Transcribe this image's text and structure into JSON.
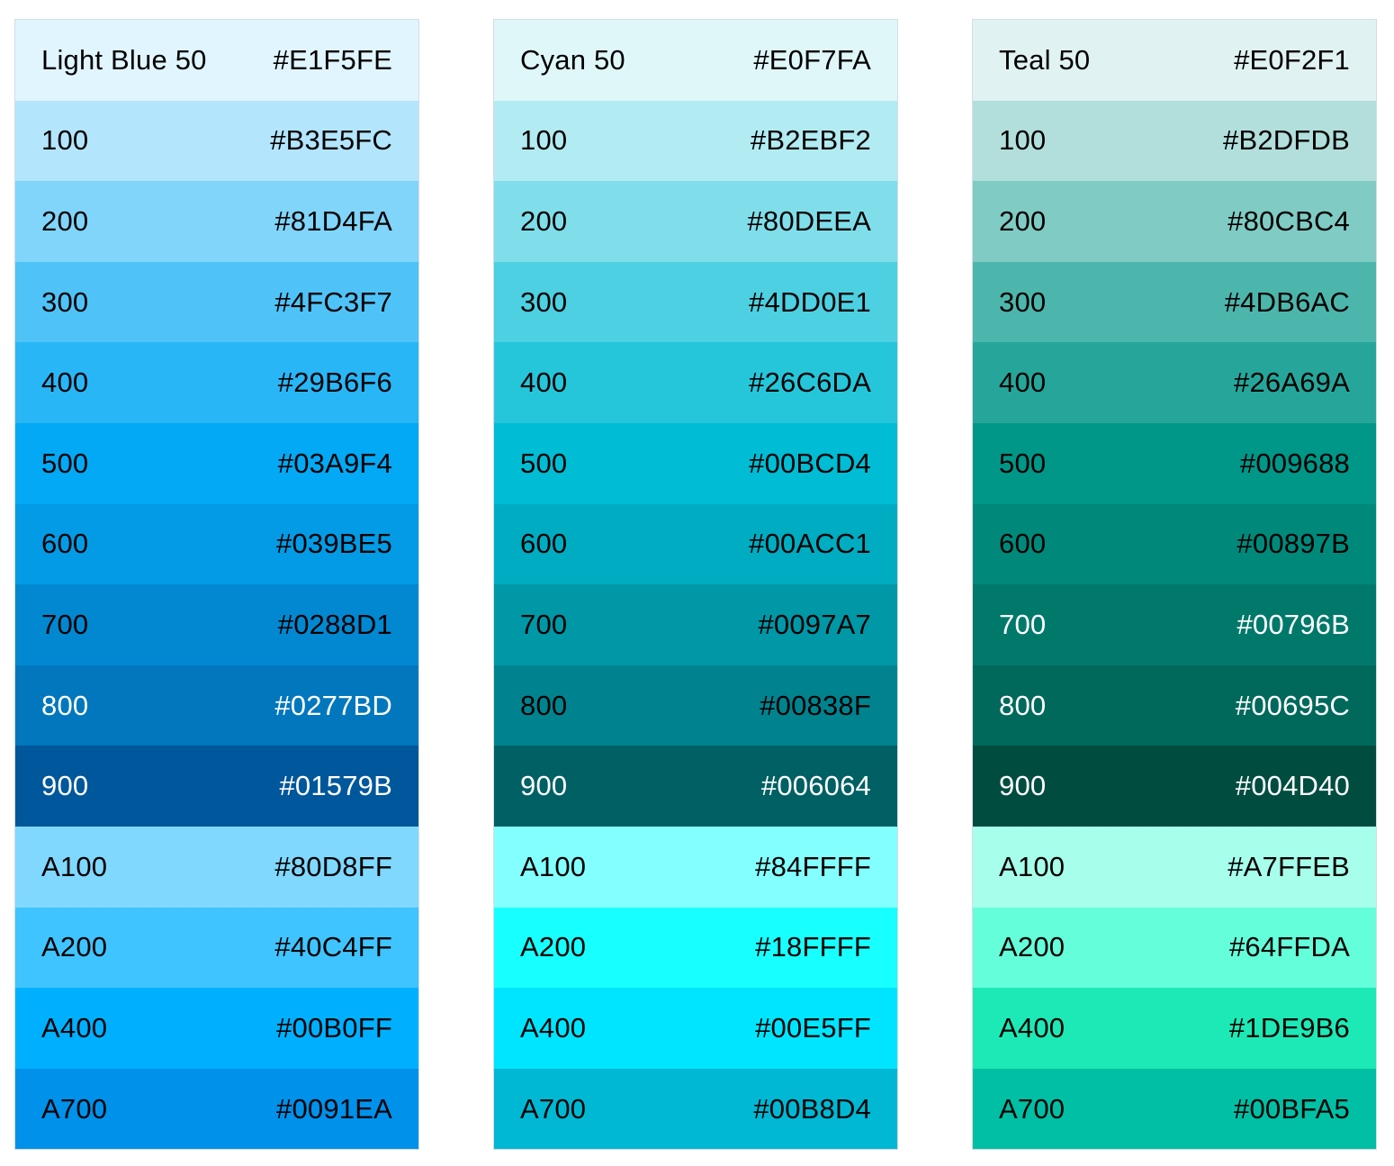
{
  "palettes": [
    {
      "name": "Light Blue",
      "swatches": [
        {
          "label": "Light Blue 50",
          "hex": "#E1F5FE",
          "bg": "#E1F5FE",
          "text": "#000000"
        },
        {
          "label": "100",
          "hex": "#B3E5FC",
          "bg": "#B3E5FC",
          "text": "#000000"
        },
        {
          "label": "200",
          "hex": "#81D4FA",
          "bg": "#81D4FA",
          "text": "#000000"
        },
        {
          "label": "300",
          "hex": "#4FC3F7",
          "bg": "#4FC3F7",
          "text": "#000000"
        },
        {
          "label": "400",
          "hex": "#29B6F6",
          "bg": "#29B6F6",
          "text": "#000000"
        },
        {
          "label": "500",
          "hex": "#03A9F4",
          "bg": "#03A9F4",
          "text": "#000000"
        },
        {
          "label": "600",
          "hex": "#039BE5",
          "bg": "#039BE5",
          "text": "#000000"
        },
        {
          "label": "700",
          "hex": "#0288D1",
          "bg": "#0288D1",
          "text": "#000000"
        },
        {
          "label": "800",
          "hex": "#0277BD",
          "bg": "#0277BD",
          "text": "#FFFFFF"
        },
        {
          "label": "900",
          "hex": "#01579B",
          "bg": "#01579B",
          "text": "#FFFFFF"
        },
        {
          "label": "A100",
          "hex": "#80D8FF",
          "bg": "#80D8FF",
          "text": "#000000"
        },
        {
          "label": "A200",
          "hex": "#40C4FF",
          "bg": "#40C4FF",
          "text": "#000000"
        },
        {
          "label": "A400",
          "hex": "#00B0FF",
          "bg": "#00B0FF",
          "text": "#000000"
        },
        {
          "label": "A700",
          "hex": "#0091EA",
          "bg": "#0091EA",
          "text": "#000000"
        }
      ]
    },
    {
      "name": "Cyan",
      "swatches": [
        {
          "label": "Cyan 50",
          "hex": "#E0F7FA",
          "bg": "#E0F7FA",
          "text": "#000000"
        },
        {
          "label": "100",
          "hex": "#B2EBF2",
          "bg": "#B2EBF2",
          "text": "#000000"
        },
        {
          "label": "200",
          "hex": "#80DEEA",
          "bg": "#80DEEA",
          "text": "#000000"
        },
        {
          "label": "300",
          "hex": "#4DD0E1",
          "bg": "#4DD0E1",
          "text": "#000000"
        },
        {
          "label": "400",
          "hex": "#26C6DA",
          "bg": "#26C6DA",
          "text": "#000000"
        },
        {
          "label": "500",
          "hex": "#00BCD4",
          "bg": "#00BCD4",
          "text": "#000000"
        },
        {
          "label": "600",
          "hex": "#00ACC1",
          "bg": "#00ACC1",
          "text": "#000000"
        },
        {
          "label": "700",
          "hex": "#0097A7",
          "bg": "#0097A7",
          "text": "#000000"
        },
        {
          "label": "800",
          "hex": "#00838F",
          "bg": "#00838F",
          "text": "#000000"
        },
        {
          "label": "900",
          "hex": "#006064",
          "bg": "#006064",
          "text": "#FFFFFF"
        },
        {
          "label": "A100",
          "hex": "#84FFFF",
          "bg": "#84FFFF",
          "text": "#000000"
        },
        {
          "label": "A200",
          "hex": "#18FFFF",
          "bg": "#18FFFF",
          "text": "#000000"
        },
        {
          "label": "A400",
          "hex": "#00E5FF",
          "bg": "#00E5FF",
          "text": "#000000"
        },
        {
          "label": "A700",
          "hex": "#00B8D4",
          "bg": "#00B8D4",
          "text": "#000000"
        }
      ]
    },
    {
      "name": "Teal",
      "swatches": [
        {
          "label": "Teal 50",
          "hex": "#E0F2F1",
          "bg": "#E0F2F1",
          "text": "#000000"
        },
        {
          "label": "100",
          "hex": "#B2DFDB",
          "bg": "#B2DFDB",
          "text": "#000000"
        },
        {
          "label": "200",
          "hex": "#80CBC4",
          "bg": "#80CBC4",
          "text": "#000000"
        },
        {
          "label": "300",
          "hex": "#4DB6AC",
          "bg": "#4DB6AC",
          "text": "#000000"
        },
        {
          "label": "400",
          "hex": "#26A69A",
          "bg": "#26A69A",
          "text": "#000000"
        },
        {
          "label": "500",
          "hex": "#009688",
          "bg": "#009688",
          "text": "#000000"
        },
        {
          "label": "600",
          "hex": "#00897B",
          "bg": "#00897B",
          "text": "#000000"
        },
        {
          "label": "700",
          "hex": "#00796B",
          "bg": "#00796B",
          "text": "#FFFFFF"
        },
        {
          "label": "800",
          "hex": "#00695C",
          "bg": "#00695C",
          "text": "#FFFFFF"
        },
        {
          "label": "900",
          "hex": "#004D40",
          "bg": "#004D40",
          "text": "#FFFFFF"
        },
        {
          "label": "A100",
          "hex": "#A7FFEB",
          "bg": "#A7FFEB",
          "text": "#000000"
        },
        {
          "label": "A200",
          "hex": "#64FFDA",
          "bg": "#64FFDA",
          "text": "#000000"
        },
        {
          "label": "A400",
          "hex": "#1DE9B6",
          "bg": "#1DE9B6",
          "text": "#000000"
        },
        {
          "label": "A700",
          "hex": "#00BFA5",
          "bg": "#00BFA5",
          "text": "#000000"
        }
      ]
    }
  ]
}
